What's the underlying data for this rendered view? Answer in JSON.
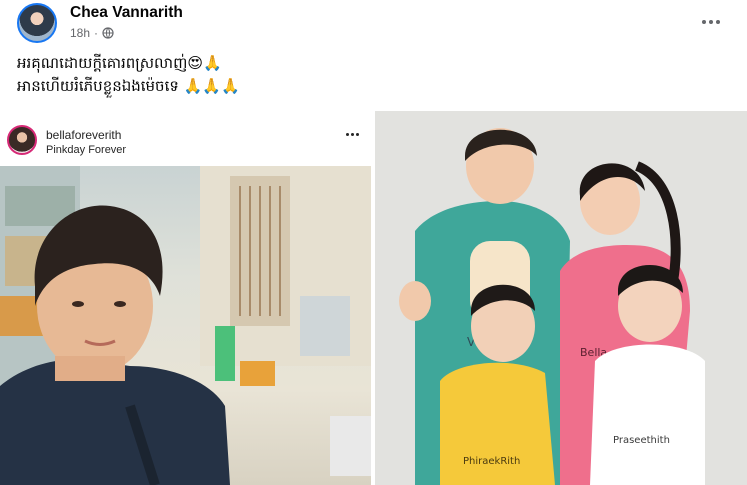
{
  "post": {
    "author": "Chea Vannarith",
    "time": "18h",
    "separator": "·",
    "caption_line1": "អរគុណដោយក្ដីគោរពស្រលាញ់😍🙏",
    "caption_line2": "អានហើយរំភើបខ្លួនឯងម៉េចទេ 🙏🙏🙏"
  },
  "embed": {
    "username": "bellaforeverith",
    "subtitle": "Pinkday Forever"
  },
  "shirts": {
    "boy_left": "PhiraekRith",
    "boy_right": "Praseethith",
    "mother": "Bella",
    "father": "V"
  },
  "colors": {
    "link_blue": "#1877f2",
    "meta_gray": "#65676b",
    "teal_shirt": "#3fa79a",
    "pink_shirt": "#ef6f8c",
    "yellow_shirt": "#f5c93a"
  }
}
